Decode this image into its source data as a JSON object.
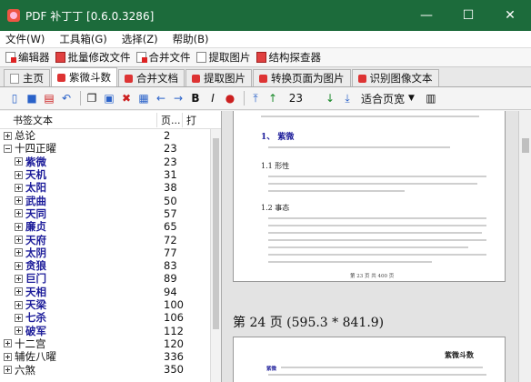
{
  "window": {
    "title": "PDF 补丁丁 [0.6.0.3286]",
    "min": "—",
    "max": "☐",
    "close": "✕"
  },
  "menu": [
    "文件(W)",
    "工具箱(G)",
    "选择(Z)",
    "帮助(B)"
  ],
  "quick": [
    "编辑器",
    "批量修改文件",
    "合并文件",
    "提取图片",
    "结构探查器"
  ],
  "tabs": [
    {
      "label": "主页",
      "active": false
    },
    {
      "label": "紫微斗数",
      "active": true
    },
    {
      "label": "合并文档",
      "active": false
    },
    {
      "label": "提取图片",
      "active": false
    },
    {
      "label": "转换页面为图片",
      "active": false
    },
    {
      "label": "识别图像文本",
      "active": false
    }
  ],
  "toolbar": {
    "page_value": "23",
    "fit_mode": "适合页宽"
  },
  "bookmarks": {
    "col_text": "书签文本",
    "col_page": "页...",
    "col_open": "打",
    "rows": [
      {
        "label": "总论",
        "page": "2",
        "level": 0,
        "expander": "closed",
        "bold": false
      },
      {
        "label": "十四正曜",
        "page": "23",
        "level": 0,
        "expander": "open",
        "bold": false
      },
      {
        "label": "紫微",
        "page": "23",
        "level": 1,
        "expander": "closed",
        "bold": true
      },
      {
        "label": "天机",
        "page": "31",
        "level": 1,
        "expander": "closed",
        "bold": true
      },
      {
        "label": "太阳",
        "page": "38",
        "level": 1,
        "expander": "closed",
        "bold": true
      },
      {
        "label": "武曲",
        "page": "50",
        "level": 1,
        "expander": "closed",
        "bold": true
      },
      {
        "label": "天同",
        "page": "57",
        "level": 1,
        "expander": "closed",
        "bold": true
      },
      {
        "label": "廉贞",
        "page": "65",
        "level": 1,
        "expander": "closed",
        "bold": true
      },
      {
        "label": "天府",
        "page": "72",
        "level": 1,
        "expander": "closed",
        "bold": true
      },
      {
        "label": "太阴",
        "page": "77",
        "level": 1,
        "expander": "closed",
        "bold": true
      },
      {
        "label": "贪狼",
        "page": "83",
        "level": 1,
        "expander": "closed",
        "bold": true
      },
      {
        "label": "巨门",
        "page": "89",
        "level": 1,
        "expander": "closed",
        "bold": true
      },
      {
        "label": "天相",
        "page": "94",
        "level": 1,
        "expander": "closed",
        "bold": true
      },
      {
        "label": "天梁",
        "page": "100",
        "level": 1,
        "expander": "closed",
        "bold": true
      },
      {
        "label": "七杀",
        "page": "106",
        "level": 1,
        "expander": "closed",
        "bold": true
      },
      {
        "label": "破军",
        "page": "112",
        "level": 1,
        "expander": "closed",
        "bold": true
      },
      {
        "label": "十二宫",
        "page": "120",
        "level": 0,
        "expander": "closed",
        "bold": false
      },
      {
        "label": "辅佐八曜",
        "page": "336",
        "level": 0,
        "expander": "closed",
        "bold": false
      },
      {
        "label": "六煞",
        "page": "350",
        "level": 0,
        "expander": "closed",
        "bold": false
      }
    ]
  },
  "viewer": {
    "section_number": "1、",
    "section_title": "紫微",
    "sub1_number": "1.1",
    "sub1_title": "形性",
    "sub2_number": "1.2",
    "sub2_title": "事态",
    "page_footer": "第 23 页 共 400 页",
    "page_header": "第 24 页 (595.3 * 841.9)",
    "next_page_title": "紫微斗数",
    "next_page_lead": "紫微"
  }
}
